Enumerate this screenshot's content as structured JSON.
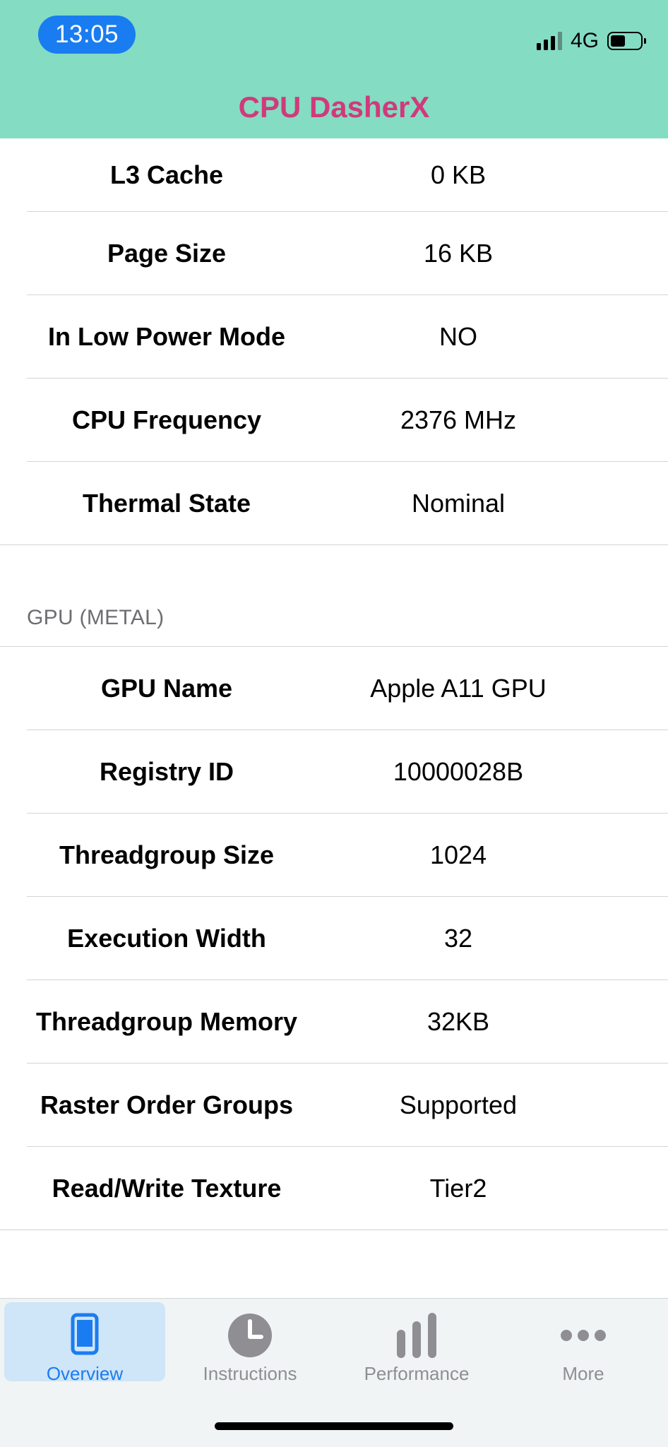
{
  "status_bar": {
    "time": "13:05",
    "network": "4G",
    "battery_level": 0.5
  },
  "app": {
    "title": "CPU DasherX",
    "title_color": "#d03a7b",
    "header_color": "#84dcc3"
  },
  "cpu_section": {
    "rows": [
      {
        "label": "L3 Cache",
        "value": "0 KB"
      },
      {
        "label": "Page Size",
        "value": "16 KB"
      },
      {
        "label": "In Low Power Mode",
        "value": "NO"
      },
      {
        "label": "CPU Frequency",
        "value": "2376 MHz"
      },
      {
        "label": "Thermal State",
        "value": "Nominal"
      }
    ]
  },
  "gpu_section": {
    "header": "GPU (METAL)",
    "rows": [
      {
        "label": "GPU Name",
        "value": "Apple A11 GPU"
      },
      {
        "label": "Registry ID",
        "value": "10000028B"
      },
      {
        "label": "Threadgroup Size",
        "value": "1024"
      },
      {
        "label": "Execution Width",
        "value": "32"
      },
      {
        "label": "Threadgroup Memory",
        "value": "32KB"
      },
      {
        "label": "Raster Order Groups",
        "value": "Supported"
      },
      {
        "label": "Read/Write Texture",
        "value": "Tier2"
      }
    ]
  },
  "tab_bar": {
    "tabs": [
      {
        "label": "Overview",
        "icon": "phone-icon",
        "active": true
      },
      {
        "label": "Instructions",
        "icon": "clock-icon",
        "active": false
      },
      {
        "label": "Performance",
        "icon": "bar-chart-icon",
        "active": false
      },
      {
        "label": "More",
        "icon": "more-dots-icon",
        "active": false
      }
    ],
    "active_color": "#1a7cf1",
    "inactive_color": "#8e8e93"
  }
}
